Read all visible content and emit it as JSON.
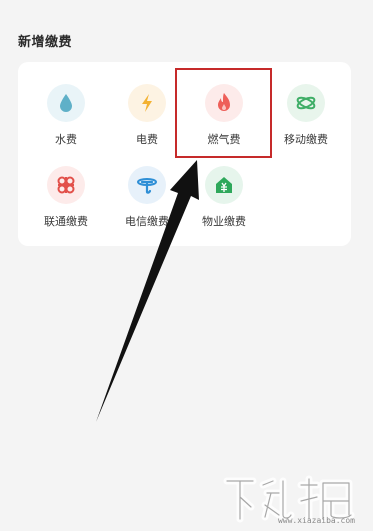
{
  "section": {
    "title": "新增缴费"
  },
  "tiles": [
    {
      "label": "水费",
      "icon": "water-drop-icon",
      "bg": "#e9f4f8",
      "fg": "#5fb0c8"
    },
    {
      "label": "电费",
      "icon": "lightning-icon",
      "bg": "#fdf3e3",
      "fg": "#f3b232"
    },
    {
      "label": "燃气费",
      "icon": "flame-icon",
      "bg": "#fdebea",
      "fg": "#ee5f59"
    },
    {
      "label": "移动缴费",
      "icon": "china-mobile-logo-icon",
      "bg": "#e8f5ec",
      "fg": "#3fae67"
    },
    {
      "label": "联通缴费",
      "icon": "china-unicom-logo-icon",
      "bg": "#fdebea",
      "fg": "#e2504a"
    },
    {
      "label": "电信缴费",
      "icon": "china-telecom-logo-icon",
      "bg": "#e7f1fa",
      "fg": "#2f8fd6"
    },
    {
      "label": "物业缴费",
      "icon": "property-house-icon",
      "bg": "#e6f5ec",
      "fg": "#2ea85b"
    }
  ],
  "colors": {
    "highlight": "#c62a2a",
    "arrow": "#111111"
  },
  "watermark": {
    "url": "www.xiazaiba.com"
  }
}
